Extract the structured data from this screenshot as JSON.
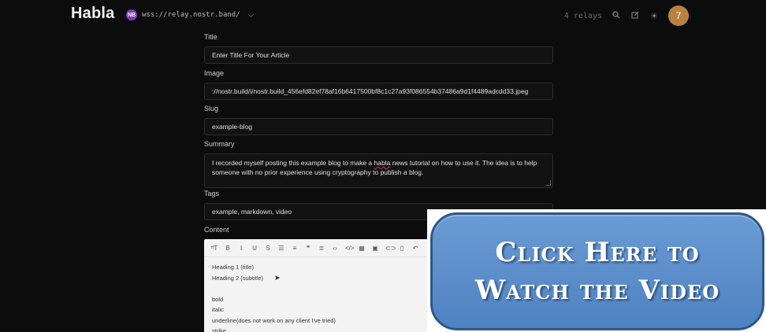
{
  "header": {
    "app_name": "Habla",
    "relay_badge": "NB",
    "relay_url": "wss://relay.nostr.band/",
    "relay_count": "4 relays",
    "avatar_initial": "7",
    "icons": [
      "chevron-down-icon",
      "search-icon",
      "edit-icon",
      "sun-icon"
    ]
  },
  "form": {
    "title_label": "Title",
    "title_placeholder": "Enter Title For Your Article",
    "image_label": "Image",
    "image_value": "://nostr.build/i/nostr.build_456efd82ef78af16b6417500bf8c1c27a93f086554b37486a9d1f4489adcdd33.jpeg",
    "slug_label": "Slug",
    "slug_value": "example-blog",
    "summary_label": "Summary",
    "summary_before": "I recorded myself posting this example blog to make a ",
    "summary_spell": "habla",
    "summary_after": " news tutorial on how to use it.  The idea is to help someone with no prior experience using cryptography to publish a blog.",
    "tags_label": "Tags",
    "tags_value": "example, markdown, video",
    "content_label": "Content"
  },
  "editor": {
    "toolbar": [
      {
        "name": "heading-icon",
        "glyph": "ᴴT"
      },
      {
        "name": "bold-icon",
        "glyph": "B"
      },
      {
        "name": "italic-icon",
        "glyph": "I"
      },
      {
        "name": "underline-icon",
        "glyph": "U"
      },
      {
        "name": "strikethrough-icon",
        "glyph": "S"
      },
      {
        "name": "bullet-list-icon",
        "glyph": "☰"
      },
      {
        "name": "numbered-list-icon",
        "glyph": "≡"
      },
      {
        "name": "quote-icon",
        "glyph": "❞"
      },
      {
        "name": "align-icon",
        "glyph": "≣"
      },
      {
        "name": "code-icon",
        "glyph": "‹›"
      },
      {
        "name": "code-block-icon",
        "glyph": "</>"
      },
      {
        "name": "table-icon",
        "glyph": "▦"
      },
      {
        "name": "image-icon",
        "glyph": "▣"
      },
      {
        "name": "link-icon",
        "glyph": "⊂⊃"
      },
      {
        "name": "delete-icon",
        "glyph": "▯"
      },
      {
        "name": "undo-icon",
        "glyph": "↶"
      }
    ],
    "lines": [
      "Heading 1 (title)",
      "Heading 2 (subtitle)",
      "",
      "bold",
      "italic",
      "underline(does not work on any client I've tried)",
      "strike"
    ]
  },
  "cta": {
    "line1": "Click Here to",
    "line2": "Watch the Video"
  }
}
